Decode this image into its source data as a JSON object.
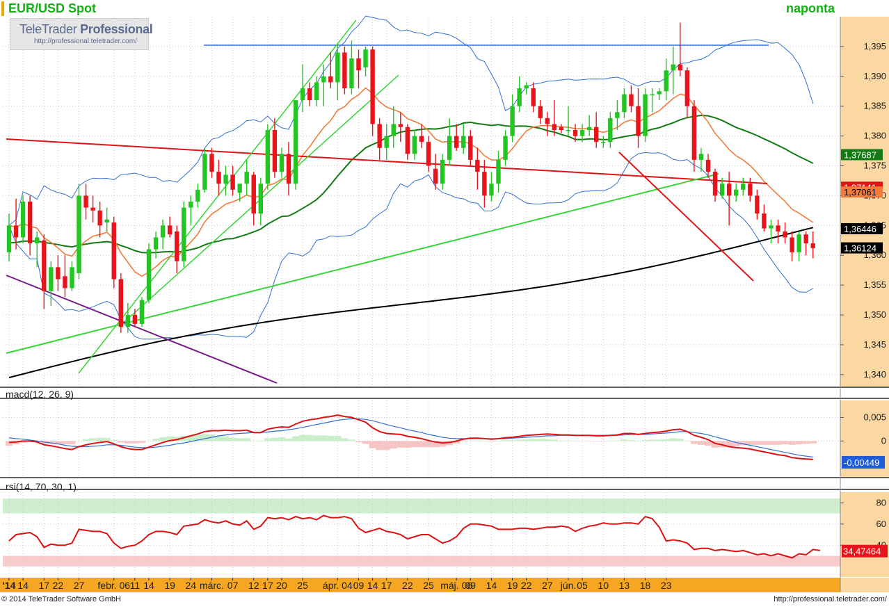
{
  "header": {
    "title": "EUR/USD Spot",
    "period": "naponta"
  },
  "logo": {
    "brand_prefix": "TeleTrader",
    "brand_suffix": "Professional",
    "url": "http://professional.teletrader.com/"
  },
  "footer": {
    "copyright": "© 2014 TeleTrader Software GmbH",
    "url": "http://professional.teletrader.com/"
  },
  "colors": {
    "up_candle": "#22c522",
    "down_candle": "#e8141c",
    "axis_bg": "#fbd7a2",
    "time_axis_bg": "#f5a623",
    "sma_long": "#000000",
    "sma_mid": "#137a13",
    "ema_short": "#f07c3c",
    "bollinger": "#2f6fd6",
    "macd": "#dd1111",
    "signal": "#2f6fd6",
    "rsi": "#dd1111",
    "rsi_overbought": "#cfeecf",
    "rsi_oversold": "#f8cccc"
  },
  "chart_data": [
    {
      "type": "candlestick",
      "title": "EUR/USD Spot",
      "interval": "naponta",
      "ylim": [
        1.338,
        1.4
      ],
      "y_ticks": [
        "1,395",
        "1,390",
        "1,385",
        "1,380",
        "1,375",
        "1,370",
        "1,365",
        "1,360",
        "1,355",
        "1,350",
        "1,345",
        "1,340"
      ],
      "y_tick_values": [
        1.395,
        1.39,
        1.385,
        1.38,
        1.375,
        1.37,
        1.365,
        1.36,
        1.355,
        1.35,
        1.345,
        1.34
      ],
      "x_ticks": [
        "'14",
        "14",
        "17",
        "22",
        "27",
        "febr. 06",
        "11",
        "14",
        "19",
        "24",
        "márc.",
        "07",
        "12",
        "17",
        "20",
        "25",
        "ápr. 04",
        "09",
        "14",
        "17",
        "22",
        "25",
        "máj. 06",
        "09",
        "14",
        "19",
        "22",
        "27",
        "jún.",
        "05",
        "10",
        "13",
        "18",
        "23"
      ],
      "x_tick_bars": [
        0,
        2,
        5,
        7,
        10,
        15,
        18,
        20,
        23,
        26,
        29,
        32,
        35,
        37,
        39,
        42,
        47,
        50,
        52,
        54,
        57,
        60,
        64,
        66,
        69,
        72,
        74,
        77,
        80,
        82,
        85,
        88,
        91,
        94
      ],
      "grid": true,
      "candles": [
        [
          1.3605,
          1.367,
          1.359,
          1.365
        ],
        [
          1.365,
          1.3695,
          1.361,
          1.363
        ],
        [
          1.363,
          1.37,
          1.362,
          1.369
        ],
        [
          1.369,
          1.37,
          1.36,
          1.362
        ],
        [
          1.362,
          1.364,
          1.358,
          1.363
        ],
        [
          1.3625,
          1.3635,
          1.351,
          1.354
        ],
        [
          1.354,
          1.359,
          1.3515,
          1.358
        ],
        [
          1.358,
          1.36,
          1.354,
          1.356
        ],
        [
          1.3565,
          1.36,
          1.353,
          1.3545
        ],
        [
          1.3545,
          1.359,
          1.354,
          1.358
        ],
        [
          1.357,
          1.372,
          1.356,
          1.37
        ],
        [
          1.37,
          1.372,
          1.366,
          1.368
        ],
        [
          1.368,
          1.37,
          1.3655,
          1.3675
        ],
        [
          1.3675,
          1.369,
          1.363,
          1.365
        ],
        [
          1.3655,
          1.368,
          1.364,
          1.366
        ],
        [
          1.3655,
          1.3665,
          1.3545,
          1.356
        ],
        [
          1.356,
          1.357,
          1.347,
          1.348
        ],
        [
          1.348,
          1.352,
          1.347,
          1.35
        ],
        [
          1.35,
          1.351,
          1.348,
          1.3485
        ],
        [
          1.3485,
          1.353,
          1.348,
          1.3525
        ],
        [
          1.3525,
          1.362,
          1.352,
          1.361
        ],
        [
          1.361,
          1.364,
          1.3595,
          1.363
        ],
        [
          1.363,
          1.366,
          1.361,
          1.365
        ],
        [
          1.365,
          1.3665,
          1.363,
          1.3635
        ],
        [
          1.364,
          1.365,
          1.357,
          1.359
        ],
        [
          1.359,
          1.369,
          1.358,
          1.368
        ],
        [
          1.368,
          1.37,
          1.365,
          1.369
        ],
        [
          1.369,
          1.372,
          1.368,
          1.371
        ],
        [
          1.371,
          1.378,
          1.3705,
          1.377
        ],
        [
          1.377,
          1.378,
          1.373,
          1.374
        ],
        [
          1.374,
          1.376,
          1.37,
          1.372
        ],
        [
          1.372,
          1.375,
          1.37,
          1.3735
        ],
        [
          1.3735,
          1.375,
          1.37,
          1.371
        ],
        [
          1.3705,
          1.372,
          1.369,
          1.372
        ],
        [
          1.372,
          1.376,
          1.37,
          1.374
        ],
        [
          1.3735,
          1.374,
          1.365,
          1.367
        ],
        [
          1.367,
          1.373,
          1.365,
          1.372
        ],
        [
          1.372,
          1.382,
          1.371,
          1.381
        ],
        [
          1.381,
          1.383,
          1.373,
          1.374
        ],
        [
          1.374,
          1.378,
          1.373,
          1.377
        ],
        [
          1.377,
          1.379,
          1.37,
          1.372
        ],
        [
          1.372,
          1.386,
          1.371,
          1.386
        ],
        [
          1.386,
          1.392,
          1.384,
          1.388
        ],
        [
          1.388,
          1.389,
          1.385,
          1.386
        ],
        [
          1.386,
          1.39,
          1.385,
          1.389
        ],
        [
          1.389,
          1.392,
          1.385,
          1.39
        ],
        [
          1.39,
          1.394,
          1.388,
          1.389
        ],
        [
          1.389,
          1.3955,
          1.386,
          1.394
        ],
        [
          1.394,
          1.395,
          1.387,
          1.388
        ],
        [
          1.388,
          1.396,
          1.387,
          1.393
        ],
        [
          1.393,
          1.3945,
          1.388,
          1.391
        ],
        [
          1.3915,
          1.395,
          1.39,
          1.3945
        ],
        [
          1.3945,
          1.395,
          1.38,
          1.382
        ],
        [
          1.382,
          1.383,
          1.376,
          1.378
        ],
        [
          1.378,
          1.382,
          1.376,
          1.38
        ],
        [
          1.38,
          1.385,
          1.378,
          1.382
        ],
        [
          1.382,
          1.384,
          1.379,
          1.3815
        ],
        [
          1.3815,
          1.382,
          1.376,
          1.377
        ],
        [
          1.377,
          1.381,
          1.376,
          1.38
        ],
        [
          1.38,
          1.382,
          1.378,
          1.379
        ],
        [
          1.379,
          1.38,
          1.374,
          1.375
        ],
        [
          1.3745,
          1.377,
          1.371,
          1.372
        ],
        [
          1.372,
          1.377,
          1.371,
          1.376
        ],
        [
          1.376,
          1.383,
          1.375,
          1.38
        ],
        [
          1.38,
          1.382,
          1.3775,
          1.378
        ],
        [
          1.378,
          1.382,
          1.377,
          1.38
        ],
        [
          1.38,
          1.381,
          1.375,
          1.376
        ],
        [
          1.376,
          1.378,
          1.371,
          1.374
        ],
        [
          1.374,
          1.376,
          1.368,
          1.37
        ],
        [
          1.37,
          1.374,
          1.369,
          1.372
        ],
        [
          1.372,
          1.3775,
          1.3705,
          1.376
        ],
        [
          1.376,
          1.381,
          1.375,
          1.38
        ],
        [
          1.38,
          1.387,
          1.379,
          1.385
        ],
        [
          1.385,
          1.39,
          1.384,
          1.388
        ],
        [
          1.388,
          1.389,
          1.387,
          1.3885
        ],
        [
          1.388,
          1.389,
          1.384,
          1.385
        ],
        [
          1.385,
          1.386,
          1.382,
          1.383
        ],
        [
          1.383,
          1.384,
          1.38,
          1.382
        ],
        [
          1.382,
          1.386,
          1.38,
          1.381
        ],
        [
          1.3815,
          1.382,
          1.3805,
          1.381
        ],
        [
          1.381,
          1.385,
          1.38,
          1.381
        ],
        [
          1.381,
          1.382,
          1.379,
          1.38
        ],
        [
          1.38,
          1.382,
          1.379,
          1.381
        ],
        [
          1.381,
          1.3835,
          1.38,
          1.3815
        ],
        [
          1.3815,
          1.384,
          1.378,
          1.379
        ],
        [
          1.379,
          1.38,
          1.378,
          1.379
        ],
        [
          1.379,
          1.384,
          1.378,
          1.383
        ],
        [
          1.383,
          1.386,
          1.381,
          1.384
        ],
        [
          1.384,
          1.388,
          1.383,
          1.387
        ],
        [
          1.387,
          1.3885,
          1.384,
          1.385
        ],
        [
          1.385,
          1.388,
          1.378,
          1.38
        ],
        [
          1.38,
          1.388,
          1.379,
          1.387
        ],
        [
          1.387,
          1.388,
          1.384,
          1.387
        ],
        [
          1.387,
          1.388,
          1.386,
          1.3875
        ],
        [
          1.3875,
          1.393,
          1.386,
          1.391
        ],
        [
          1.391,
          1.395,
          1.387,
          1.392
        ],
        [
          1.392,
          1.399,
          1.39,
          1.391
        ],
        [
          1.391,
          1.3915,
          1.383,
          1.385
        ],
        [
          1.385,
          1.386,
          1.374,
          1.376
        ],
        [
          1.376,
          1.378,
          1.374,
          1.377
        ],
        [
          1.376,
          1.377,
          1.373,
          1.374
        ],
        [
          1.374,
          1.3745,
          1.369,
          1.37
        ],
        [
          1.37,
          1.373,
          1.3695,
          1.372
        ],
        [
          1.372,
          1.374,
          1.365,
          1.37
        ],
        [
          1.37,
          1.372,
          1.369,
          1.371
        ],
        [
          1.371,
          1.373,
          1.37,
          1.372
        ],
        [
          1.372,
          1.373,
          1.369,
          1.37
        ],
        [
          1.37,
          1.371,
          1.366,
          1.367
        ],
        [
          1.367,
          1.3685,
          1.364,
          1.3645
        ],
        [
          1.3645,
          1.366,
          1.362,
          1.365
        ],
        [
          1.365,
          1.366,
          1.362,
          1.364
        ],
        [
          1.364,
          1.3655,
          1.362,
          1.363
        ],
        [
          1.363,
          1.364,
          1.359,
          1.3605
        ],
        [
          1.3605,
          1.364,
          1.359,
          1.3635
        ],
        [
          1.3635,
          1.364,
          1.36,
          1.362
        ],
        [
          1.362,
          1.364,
          1.3595,
          1.3612
        ]
      ],
      "indicators": {
        "sma200_last": "1,36446",
        "sma50_last": "1,37687",
        "ema_short_last": "1,37141",
        "trend_level": "1,37061",
        "last_price": "1,36124"
      },
      "last_labels": [
        "1,37687",
        "1,37141",
        "1,37061",
        "1,36446",
        "1,36124"
      ]
    },
    {
      "type": "line",
      "title": "macd(12, 26, 9)",
      "ylim": [
        -0.0076,
        0.0086
      ],
      "y_ticks": [
        "0,005",
        "0"
      ],
      "y_tick_values": [
        0.005,
        0
      ],
      "last_value": "-0,00449",
      "macd": [
        -0.0003,
        -0.0002,
        0.0,
        0.0,
        -0.0002,
        -0.0008,
        -0.001,
        -0.0013,
        -0.0016,
        -0.0018,
        -0.0012,
        -0.0008,
        -0.0005,
        -0.0003,
        -0.0001,
        -0.0006,
        -0.0012,
        -0.0016,
        -0.0018,
        -0.0018,
        -0.0013,
        -0.0008,
        -0.0003,
        0.0001,
        0.0003,
        0.0007,
        0.0011,
        0.0015,
        0.002,
        0.0022,
        0.0022,
        0.0023,
        0.0022,
        0.0022,
        0.0023,
        0.0018,
        0.0018,
        0.0025,
        0.0028,
        0.003,
        0.0029,
        0.0036,
        0.0042,
        0.0045,
        0.0047,
        0.005,
        0.0052,
        0.0055,
        0.0052,
        0.005,
        0.0045,
        0.004,
        0.0028,
        0.002,
        0.0016,
        0.0015,
        0.0014,
        0.001,
        0.0008,
        0.0005,
        0.0001,
        -0.0002,
        -0.0004,
        -0.0003,
        0.0,
        0.0004,
        0.0006,
        0.0006,
        0.0005,
        0.0004,
        0.0005,
        0.0007,
        0.0008,
        0.001,
        0.0012,
        0.0013,
        0.0014,
        0.0015,
        0.0014,
        0.0013,
        0.0013,
        0.0012,
        0.0012,
        0.0012,
        0.0011,
        0.0011,
        0.0012,
        0.0013,
        0.0016,
        0.0016,
        0.0014,
        0.0016,
        0.0018,
        0.0019,
        0.0021,
        0.0024,
        0.0025,
        0.002,
        0.0012,
        0.0008,
        0.0003,
        -0.0005,
        -0.0008,
        -0.0012,
        -0.0014,
        -0.0015,
        -0.0017,
        -0.002,
        -0.0023,
        -0.0026,
        -0.0029,
        -0.0031,
        -0.0035,
        -0.0037,
        -0.0038,
        -0.0039
      ],
      "signal": [
        0.0007,
        0.0005,
        0.0004,
        0.0002,
        0.0,
        -0.0002,
        -0.0004,
        -0.0006,
        -0.0009,
        -0.0011,
        -0.0012,
        -0.0012,
        -0.0011,
        -0.001,
        -0.0008,
        -0.0008,
        -0.0009,
        -0.0011,
        -0.0013,
        -0.0014,
        -0.0014,
        -0.0013,
        -0.0011,
        -0.0009,
        -0.0006,
        -0.0004,
        -0.0001,
        0.0002,
        0.0005,
        0.0008,
        0.0011,
        0.0013,
        0.0015,
        0.0016,
        0.0017,
        0.0018,
        0.0018,
        0.0019,
        0.0021,
        0.0022,
        0.0024,
        0.0026,
        0.0029,
        0.0032,
        0.0035,
        0.0038,
        0.0041,
        0.0044,
        0.0046,
        0.0047,
        0.0047,
        0.0046,
        0.0043,
        0.0039,
        0.0035,
        0.0031,
        0.0028,
        0.0024,
        0.0021,
        0.0018,
        0.0014,
        0.0011,
        0.0008,
        0.0006,
        0.0005,
        0.0005,
        0.0005,
        0.0005,
        0.0005,
        0.0005,
        0.0005,
        0.0005,
        0.0006,
        0.0007,
        0.0008,
        0.0009,
        0.001,
        0.0011,
        0.0011,
        0.0012,
        0.0012,
        0.0012,
        0.0012,
        0.0012,
        0.0012,
        0.0012,
        0.0012,
        0.0012,
        0.0013,
        0.0014,
        0.0014,
        0.0014,
        0.0015,
        0.0016,
        0.0017,
        0.0018,
        0.002,
        0.002,
        0.0018,
        0.0016,
        0.0013,
        0.0009,
        0.0005,
        0.0001,
        -0.0003,
        -0.0006,
        -0.0009,
        -0.0012,
        -0.0015,
        -0.0018,
        -0.0021,
        -0.0024,
        -0.0027,
        -0.003,
        -0.0032,
        -0.0034
      ]
    },
    {
      "type": "line",
      "title": "rsi(14, 70, 30, 1)",
      "ylim": [
        10,
        90
      ],
      "y_ticks": [
        "80",
        "60",
        "40"
      ],
      "y_tick_values": [
        80,
        60,
        40
      ],
      "overbought": 70,
      "oversold": 30,
      "last_value": "34,47464",
      "values": [
        44,
        50,
        51,
        52,
        48,
        38,
        41,
        40,
        40,
        42,
        55,
        54,
        53,
        53,
        51,
        42,
        37,
        39,
        40,
        44,
        50,
        53,
        53,
        52,
        50,
        58,
        59,
        60,
        64,
        62,
        61,
        63,
        60,
        59,
        63,
        55,
        58,
        66,
        65,
        66,
        64,
        67,
        65,
        66,
        64,
        68,
        66,
        66,
        67,
        65,
        56,
        52,
        54,
        56,
        53,
        52,
        50,
        46,
        48,
        50,
        50,
        46,
        42,
        44,
        48,
        56,
        60,
        60,
        59,
        58,
        55,
        55,
        55,
        56,
        56,
        55,
        56,
        57,
        57,
        58,
        57,
        53,
        56,
        58,
        59,
        61,
        60,
        60,
        61,
        61,
        60,
        67,
        65,
        57,
        44,
        45,
        44,
        42,
        36,
        37,
        37,
        35,
        36,
        35,
        34,
        35,
        33,
        31,
        32,
        30,
        32,
        30,
        28,
        32,
        31,
        36,
        35
      ]
    }
  ]
}
